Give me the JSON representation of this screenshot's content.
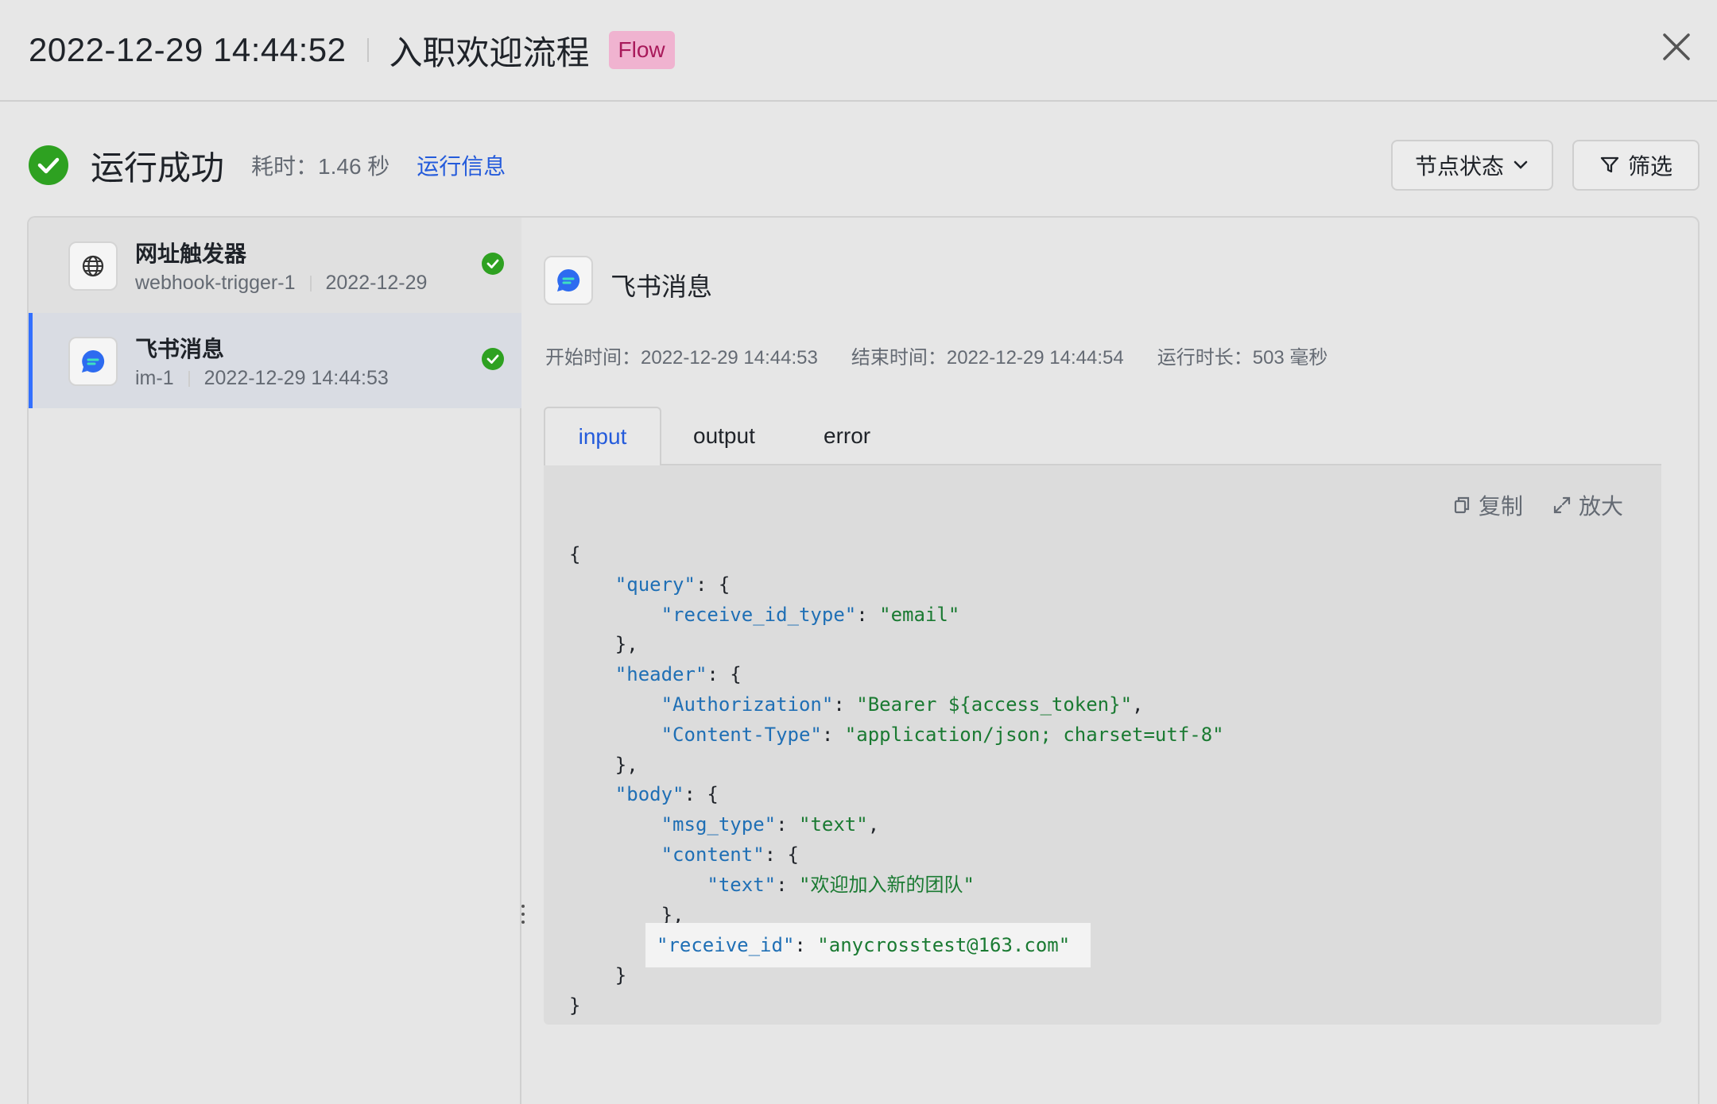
{
  "header": {
    "run_time": "2022-12-29 14:44:52",
    "flow_name": "入职欢迎流程",
    "badge": "Flow"
  },
  "status": {
    "title": "运行成功",
    "duration": "耗时：1.46 秒",
    "run_info_link": "运行信息"
  },
  "toolbar": {
    "node_state_label": "节点状态",
    "filter_label": "筛选"
  },
  "nodes": [
    {
      "title": "网址触发器",
      "id": "webhook-trigger-1",
      "time": "2022-12-29",
      "icon": "globe-icon",
      "status": "success"
    },
    {
      "title": "飞书消息",
      "id": "im-1",
      "time": "2022-12-29 14:44:53",
      "icon": "lark-message-icon",
      "status": "success",
      "selected": true
    }
  ],
  "detail": {
    "title": "飞书消息",
    "start": "开始时间：2022-12-29 14:44:53",
    "end": "结束时间：2022-12-29 14:44:54",
    "duration": "运行时长：503 毫秒",
    "tabs": [
      "input",
      "output",
      "error"
    ],
    "active_tab": "input",
    "copy_label": "复制",
    "expand_label": "放大",
    "code_lines": [
      "{",
      "    \"query\": {",
      "        \"receive_id_type\": \"email\"",
      "    },",
      "    \"header\": {",
      "        \"Authorization\": \"Bearer ${access_token}\",",
      "        \"Content-Type\": \"application/json; charset=utf-8\"",
      "    },",
      "    \"body\": {",
      "        \"msg_type\": \"text\",",
      "        \"content\": {",
      "            \"text\": \"欢迎加入新的团队\"",
      "        },",
      "        \"receive_id\": \"anycrosstest@163.com\"",
      "    }",
      "}"
    ]
  },
  "colors": {
    "accent": "#245bdb",
    "success": "#2ea121",
    "badge_bg": "#f0b3d0",
    "badge_fg": "#a8195a",
    "json_key": "#1f6fb5",
    "json_string": "#1a7a32"
  }
}
